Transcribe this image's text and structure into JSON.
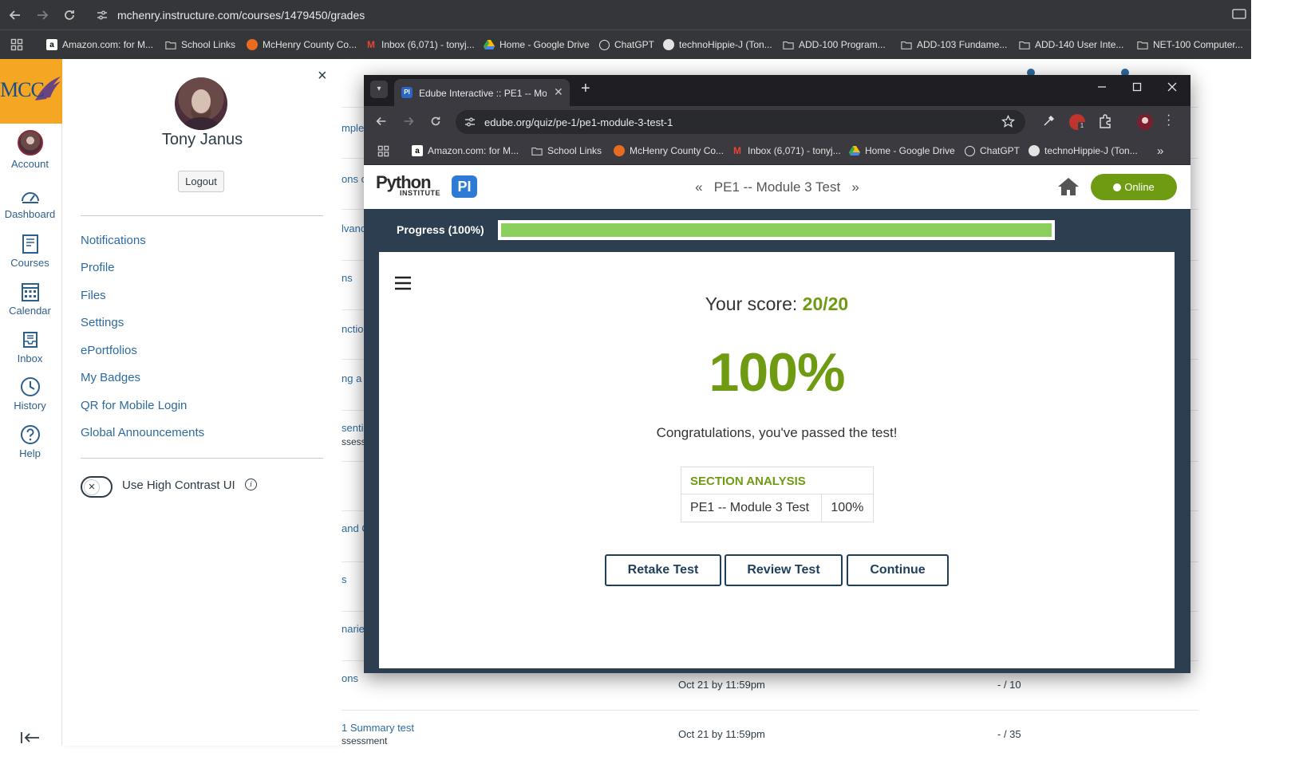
{
  "outer_browser": {
    "url": "mchenry.instructure.com/courses/1479450/grades",
    "bookmarks": [
      {
        "label": "Amazon.com: for M...",
        "icon": "amazon-icon"
      },
      {
        "label": "School Links",
        "icon": "folder-icon"
      },
      {
        "label": "McHenry County Co...",
        "icon": "mcc-icon"
      },
      {
        "label": "Inbox (6,071) - tonyj...",
        "icon": "gmail-icon"
      },
      {
        "label": "Home - Google Drive",
        "icon": "drive-icon"
      },
      {
        "label": "ChatGPT",
        "icon": "chatgpt-icon"
      },
      {
        "label": "technoHippie-J (Ton...",
        "icon": "github-icon"
      },
      {
        "label": "ADD-100 Program...",
        "icon": "folder-icon"
      },
      {
        "label": "ADD-103 Fundame...",
        "icon": "folder-icon"
      },
      {
        "label": "ADD-140 User Inte...",
        "icon": "folder-icon"
      },
      {
        "label": "NET-100 Computer...",
        "icon": "folder-icon"
      }
    ]
  },
  "canvas_nav": {
    "logo": "MCC",
    "items": [
      {
        "label": "Account",
        "icon": "avatar"
      },
      {
        "label": "Dashboard",
        "icon": "dashboard-icon"
      },
      {
        "label": "Courses",
        "icon": "courses-icon"
      },
      {
        "label": "Calendar",
        "icon": "calendar-icon"
      },
      {
        "label": "Inbox",
        "icon": "inbox-icon"
      },
      {
        "label": "History",
        "icon": "history-icon"
      },
      {
        "label": "Help",
        "icon": "help-icon"
      }
    ]
  },
  "account_tray": {
    "name": "Tony Janus",
    "logout": "Logout",
    "close": "×",
    "links": [
      "Notifications",
      "Profile",
      "Files",
      "Settings",
      "ePortfolios",
      "My Badges",
      "QR for Mobile Login",
      "Global Announcements"
    ],
    "high_contrast_label": "Use High Contrast UI",
    "high_contrast_on": false,
    "toggle_mark": "✕",
    "info": "i"
  },
  "background_grades": {
    "fragments": [
      "mple",
      "ons o",
      "lvanc",
      "ns",
      "nctio",
      "ng a F",
      "sentia",
      "ssess",
      "and C",
      "s",
      "narie",
      "ons"
    ],
    "rows": [
      {
        "name": "ons",
        "due": "Oct 21 by 11:59pm",
        "score": "- / 10"
      },
      {
        "name": "1 Summary test",
        "sub": "ssessment",
        "due": "Oct 21 by 11:59pm",
        "score": "- / 35"
      }
    ]
  },
  "quiz_window": {
    "tab_title": "Edube Interactive :: PE1 -- Module 3 Test",
    "tab_favicon": "PI",
    "url": "edube.org/quiz/pe-1/pe1-module-3-test-1",
    "bookmarks": [
      {
        "label": "Amazon.com: for M...",
        "icon": "amazon-icon"
      },
      {
        "label": "School Links",
        "icon": "folder-icon"
      },
      {
        "label": "McHenry County Co...",
        "icon": "mcc-icon"
      },
      {
        "label": "Inbox (6,071) - tonyj...",
        "icon": "gmail-icon"
      },
      {
        "label": "Home - Google Drive",
        "icon": "drive-icon"
      },
      {
        "label": "ChatGPT",
        "icon": "chatgpt-icon"
      },
      {
        "label": "technoHippie-J (Ton...",
        "icon": "github-icon"
      }
    ],
    "extension_badge": "1",
    "logo_text": "Python",
    "logo_sub": "INSTITUTE",
    "logo_badge": "PI",
    "page_title": "PE1 -- Module 3 Test",
    "prev": "«",
    "next": "»",
    "online_label": "Online",
    "progress_label": "Progress (100%)",
    "progress_value": 1.0,
    "score_label": "Your score:",
    "score_value": "20/20",
    "percent": "100%",
    "congrats": "Congratulations, you've passed the test!",
    "section_analysis": {
      "header": "SECTION ANALYSIS",
      "rows": [
        {
          "section": "PE1 -- Module 3 Test",
          "score": "100%"
        }
      ]
    },
    "buttons": {
      "retake": "Retake Test",
      "review": "Review Test",
      "continue": "Continue"
    },
    "colors": {
      "accent": "#6f9b12",
      "progress": "#8bd05c",
      "navy": "#2c3e50",
      "button": "#1e3e5c"
    }
  }
}
